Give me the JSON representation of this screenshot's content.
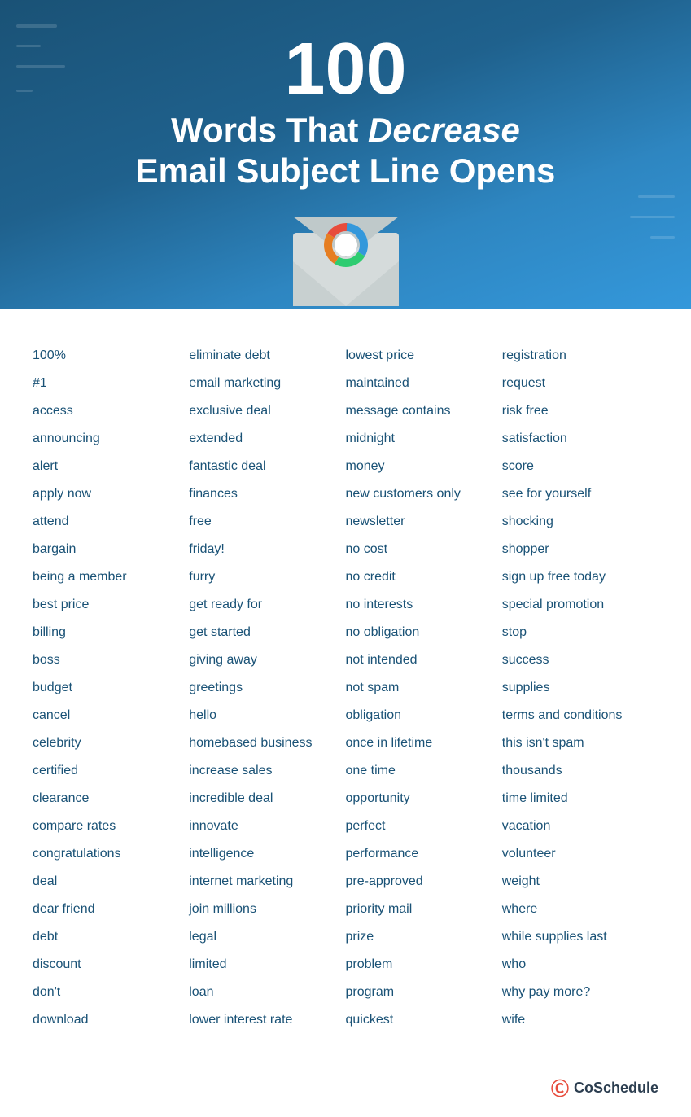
{
  "header": {
    "big_number": "100",
    "title_part1": "Words That ",
    "title_italic": "Decrease",
    "title_line2": "Email Subject Line Opens"
  },
  "columns": {
    "col1": [
      "100%",
      "#1",
      "access",
      "announcing",
      "alert",
      "apply now",
      "attend",
      "bargain",
      "being a member",
      "best price",
      "billing",
      "boss",
      "budget",
      "cancel",
      "celebrity",
      "certified",
      "clearance",
      "compare rates",
      "congratulations",
      "deal",
      "dear friend",
      "debt",
      "discount",
      "don't",
      "download"
    ],
    "col2": [
      "eliminate debt",
      "email marketing",
      "exclusive deal",
      "extended",
      "fantastic deal",
      "finances",
      "free",
      "friday!",
      "furry",
      "get ready for",
      "get started",
      "giving away",
      "greetings",
      "hello",
      "homebased business",
      "increase sales",
      "incredible deal",
      "innovate",
      "intelligence",
      "internet marketing",
      "join millions",
      "legal",
      "limited",
      "loan",
      "lower interest rate"
    ],
    "col3": [
      "lowest price",
      "maintained",
      "message contains",
      "midnight",
      "money",
      "new customers only",
      "newsletter",
      "no cost",
      "no credit",
      "no interests",
      "no obligation",
      "not intended",
      "not spam",
      "obligation",
      "once in lifetime",
      "one time",
      "opportunity",
      "perfect",
      "performance",
      "pre-approved",
      "priority mail",
      "prize",
      "problem",
      "program",
      "quickest"
    ],
    "col4": [
      "registration",
      "request",
      "risk free",
      "satisfaction",
      "score",
      "see for yourself",
      "shocking",
      "shopper",
      "sign up free today",
      "special promotion",
      "stop",
      "success",
      "supplies",
      "terms and conditions",
      "this isn't spam",
      "thousands",
      "time limited",
      "vacation",
      "volunteer",
      "weight",
      "where",
      "while supplies last",
      "who",
      "why pay more?",
      "wife"
    ]
  },
  "footer": {
    "logo_text": "CoSchedule"
  }
}
